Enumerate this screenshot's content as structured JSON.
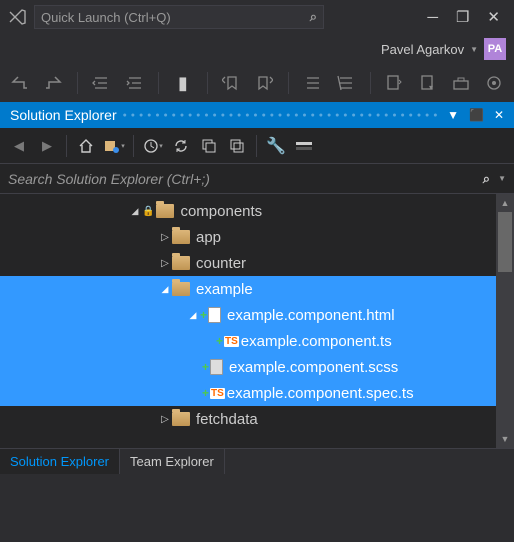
{
  "titlebar": {
    "quick_launch_placeholder": "Quick Launch (Ctrl+Q)"
  },
  "account": {
    "username": "Pavel Agarkov",
    "initials": "PA"
  },
  "panel": {
    "title": "Solution Explorer"
  },
  "search": {
    "placeholder": "Search Solution Explorer (Ctrl+;)"
  },
  "tree": {
    "components": "components",
    "app": "app",
    "counter": "counter",
    "example": "example",
    "example_html": "example.component.html",
    "example_ts": "example.component.ts",
    "example_scss": "example.component.scss",
    "example_spec": "example.component.spec.ts",
    "fetchdata": "fetchdata"
  },
  "tabs": {
    "solution": "Solution Explorer",
    "team": "Team Explorer"
  }
}
